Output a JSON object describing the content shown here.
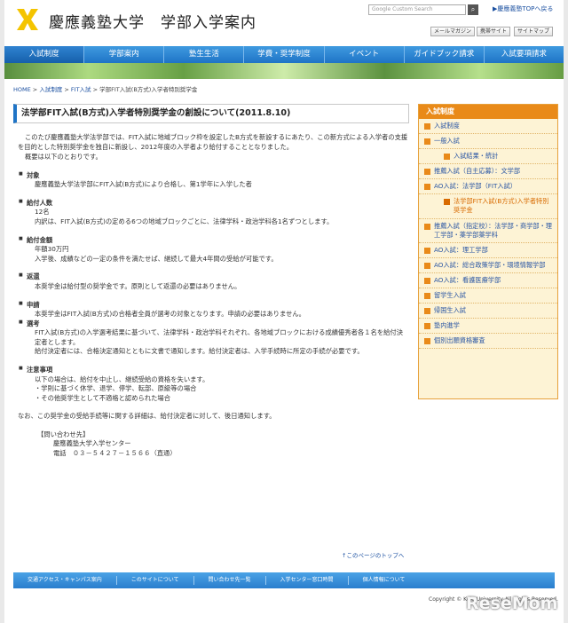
{
  "header": {
    "site_title": "慶應義塾大学　学部入学案内",
    "search_placeholder": "Google Custom Search",
    "top_link": "▶慶應義塾TOPへ戻る",
    "utility_links": [
      "メールマガジン",
      "携帯サイト",
      "サイトマップ"
    ]
  },
  "nav": [
    "入試制度",
    "学部案内",
    "塾生生活",
    "学費・奨学制度",
    "イベント",
    "ガイドブック請求",
    "入試要項請求"
  ],
  "breadcrumb": {
    "items": [
      "HOME",
      "入試制度",
      "FIT入試"
    ],
    "current": "学部FIT入試(B方式)入学者特別奨学金"
  },
  "main": {
    "title": "法学部FIT入試(B方式)入学者特別奨学金の創設について(2011.8.10)",
    "intro": "このたび慶應義塾大学法学部では、FIT入試に地域ブロック枠を設定したB方式を新設するにあたり、この新方式による入学者の支援を目的とした特別奨学金を独自に新設し、2012年度の入学者より給付することとなりました。",
    "intro2": "概要は以下のとおりです。",
    "sections": [
      {
        "head": "対象",
        "lines": [
          "慶應義塾大学法学部にFIT入試(B方式)により合格し、第1学年に入学した者"
        ]
      },
      {
        "head": "給付人数",
        "lines": [
          "12名",
          "内訳は、FIT入試(B方式)の定める6つの地域ブロックごとに、法律学科・政治学科各1名ずつとします。"
        ]
      },
      {
        "head": "給付金額",
        "lines": [
          "年額30万円",
          "入学後、成績などの一定の条件を満たせば、継続して最大4年間の受給が可能です。"
        ]
      },
      {
        "head": "返還",
        "lines": [
          "本奨学金は給付型の奨学金です。原則として返還の必要はありません。"
        ]
      }
    ],
    "apply_head": "申請",
    "apply_line": "本奨学金はFIT入試(B方式)の合格者全員が選考の対象となります。申請の必要はありません。",
    "select_head": "選考",
    "select_lines": [
      "FIT入試(B方式)の入学選考結果に基づいて、法律学科・政治学科それぞれ、各地域ブロックにおける成績優秀者各１名を給付決定者とします。",
      "給付決定者には、合格決定通知とともに文書で通知します。給付決定者は、入学手続時に所定の手続が必要です。"
    ],
    "notes_head": "注意事項",
    "notes_line": "以下の場合は、給付を中止し、継続受給の資格を失います。",
    "notes_items": [
      "・学則に基づく休学、退学、停学、転部、原級等の場合",
      "・その他奨学生として不適格と認められた場合"
    ],
    "closing": "なお、この奨学金の受給手続等に関する詳細は、給付決定者に対して、後日通知します。",
    "contact": {
      "label": "【問い合わせ先】",
      "org": "慶應義塾大学入学センター",
      "phone": "電話　０３－５４２７－１５６６（直通）"
    },
    "pagetop": "↑このページのトップへ"
  },
  "sidebar": {
    "heading": "入試制度",
    "items": [
      {
        "label": "入試制度",
        "level": 0
      },
      {
        "label": "一般入試",
        "level": 0
      },
      {
        "label": "入試結果・統計",
        "level": 1
      },
      {
        "label": "推薦入試（自主応募）：文学部",
        "level": 0
      },
      {
        "label": "AO入試：法学部（FIT入試）",
        "level": 0
      },
      {
        "label": "法学部FIT入試(B方式)入学者特別奨学金",
        "level": 1,
        "current": true
      },
      {
        "label": "推薦入試（指定校）：法学部・商学部・理工学部・薬学部薬学科",
        "level": 0
      },
      {
        "label": "AO入試：理工学部",
        "level": 0
      },
      {
        "label": "AO入試：総合政策学部・環境情報学部",
        "level": 0
      },
      {
        "label": "AO入試：看護医療学部",
        "level": 0
      },
      {
        "label": "留学生入試",
        "level": 0
      },
      {
        "label": "帰国生入試",
        "level": 0
      },
      {
        "label": "塾内進学",
        "level": 0
      },
      {
        "label": "個別出願資格審査",
        "level": 0
      }
    ]
  },
  "footer": {
    "links": [
      "交通アクセス・キャンパス案内",
      "このサイトについて",
      "問い合わせ先一覧",
      "入学センター窓口時間",
      "個人情報について"
    ],
    "copyright": "Copyright © Keio University All Rights Reserved.",
    "watermark": "ReseMom"
  },
  "colors": {
    "nav": "#1f74c6",
    "sidebar_accent": "#e98a19",
    "logo": "#f4c400"
  }
}
